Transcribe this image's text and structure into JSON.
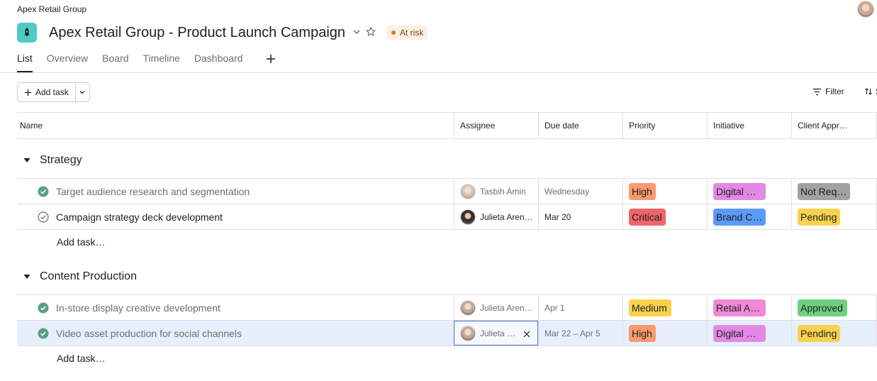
{
  "header": {
    "org_name": "Apex Retail Group",
    "project_title": "Apex Retail Group - Product Launch Campaign",
    "status_label": "At risk",
    "status_color": "#c67f2d"
  },
  "tabs": [
    {
      "label": "List"
    },
    {
      "label": "Overview"
    },
    {
      "label": "Board"
    },
    {
      "label": "Timeline"
    },
    {
      "label": "Dashboard"
    }
  ],
  "toolbar": {
    "add_task_label": "Add task",
    "filter_label": "Filter",
    "sort_label": "S"
  },
  "columns": {
    "name": "Name",
    "assignee": "Assignee",
    "due": "Due date",
    "priority": "Priority",
    "initiative": "Initiative",
    "client": "Client Appr…"
  },
  "sections": [
    {
      "title": "Strategy",
      "add_label": "Add task…",
      "tasks": [
        {
          "name": "Target audience research and segmentation",
          "completed": true,
          "assignee": "Tasbih Amin",
          "due": "Wednesday",
          "priority": "High",
          "priority_color": "#fb9a6e",
          "initiative": "Digital …",
          "initiative_color": "#e389e5",
          "client": "Not Req…",
          "client_color": "#a1a1a1"
        },
        {
          "name": "Campaign strategy deck development",
          "completed": false,
          "assignee": "Julieta Aren…",
          "due": "Mar 20",
          "priority": "Critical",
          "priority_color": "#f0636a",
          "initiative": "Brand C…",
          "initiative_color": "#5b9bf8",
          "client": "Pending",
          "client_color": "#f8d24d"
        }
      ]
    },
    {
      "title": "Content Production",
      "add_label": "Add task…",
      "tasks": [
        {
          "name": "In-store display creative development",
          "completed": true,
          "assignee": "Julieta Aren…",
          "due": "Apr 1",
          "priority": "Medium",
          "priority_color": "#f8d24d",
          "initiative": "Retail A…",
          "initiative_color": "#f08ad7",
          "client": "Approved",
          "client_color": "#6fcf83"
        },
        {
          "name": "Video asset production for social channels",
          "completed": true,
          "assignee": "Julieta …",
          "due": "Mar 22 – Apr 5",
          "priority": "High",
          "priority_color": "#fb9a6e",
          "initiative": "Digital …",
          "initiative_color": "#e389e5",
          "client": "Pending",
          "client_color": "#f8d24d"
        }
      ]
    }
  ]
}
